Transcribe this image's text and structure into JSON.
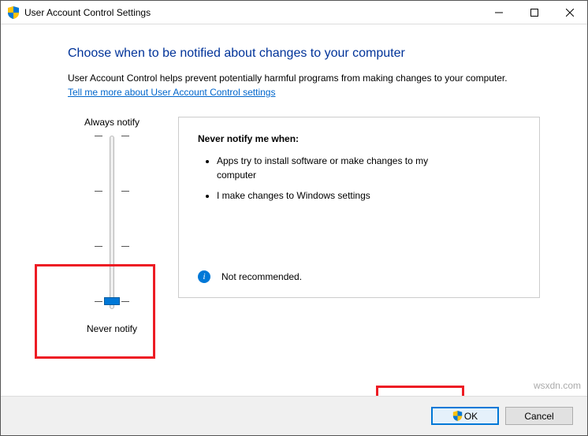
{
  "window": {
    "title": "User Account Control Settings"
  },
  "heading": "Choose when to be notified about changes to your computer",
  "description": "User Account Control helps prevent potentially harmful programs from making changes to your computer.",
  "link_text": "Tell me more about User Account Control settings",
  "slider": {
    "top_label": "Always notify",
    "bottom_label": "Never notify",
    "level": 0
  },
  "panel": {
    "title": "Never notify me when:",
    "bullets": [
      "Apps try to install software or make changes to my computer",
      "I make changes to Windows settings"
    ],
    "recommendation": "Not recommended."
  },
  "buttons": {
    "ok": "OK",
    "cancel": "Cancel"
  },
  "watermark": "wsxdn.com"
}
